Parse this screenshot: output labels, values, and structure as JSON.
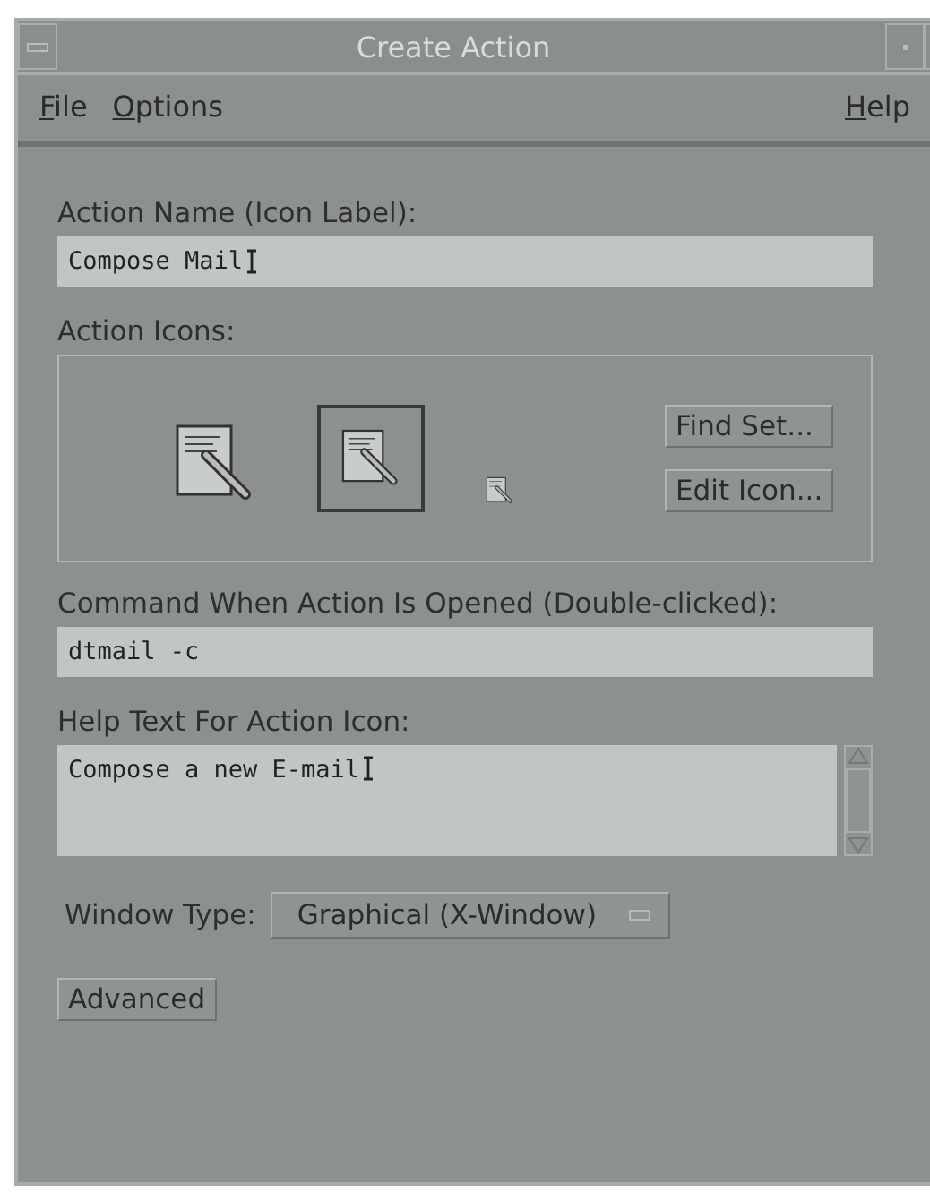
{
  "window": {
    "title": "Create Action"
  },
  "menu": {
    "left": [
      {
        "underlined": "F",
        "after": "ile"
      },
      {
        "underlined": "O",
        "after": "ptions"
      }
    ],
    "right": [
      {
        "underlined": "H",
        "after": "elp"
      }
    ]
  },
  "action_name": {
    "label": "Action Name (Icon Label):",
    "value": "Compose Mail"
  },
  "action_icons": {
    "label": "Action Icons:",
    "icons": [
      {
        "kind": "large",
        "selected": false
      },
      {
        "kind": "medium",
        "selected": true
      },
      {
        "kind": "small",
        "selected": false
      }
    ],
    "buttons": [
      "Find Set...",
      "Edit Icon..."
    ]
  },
  "command": {
    "label": "Command When Action Is Opened (Double-clicked):",
    "value": "dtmail -c"
  },
  "help_text": {
    "label": "Help Text For Action Icon:",
    "value": "Compose a new E-mail"
  },
  "window_type": {
    "label": "Window Type:",
    "value": "Graphical (X-Window)"
  },
  "advanced_button": "Advanced"
}
